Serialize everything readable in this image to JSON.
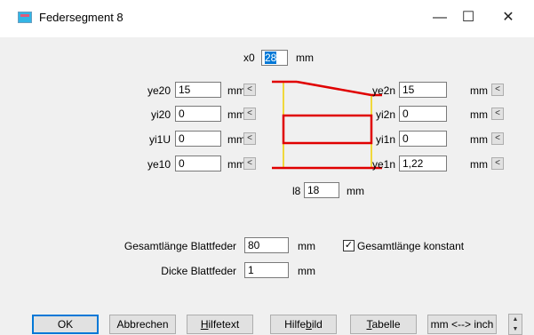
{
  "window": {
    "title": "Federsegment 8",
    "minimize": "—",
    "maximize": "☐",
    "close": "✕"
  },
  "x0": {
    "label": "x0",
    "value": "28",
    "unit": "mm"
  },
  "left_fields": [
    {
      "label": "ye20",
      "value": "15",
      "unit": "mm",
      "btn": "<"
    },
    {
      "label": "yi20",
      "value": "0",
      "unit": "mm",
      "btn": "<"
    },
    {
      "label": "yi1U",
      "value": "0",
      "unit": "mm",
      "btn": "<"
    },
    {
      "label": "ye10",
      "value": "0",
      "unit": "mm",
      "btn": "<"
    }
  ],
  "right_fields": [
    {
      "label": "ye2n",
      "value": "15",
      "unit": "mm",
      "btn": "<"
    },
    {
      "label": "yi2n",
      "value": "0",
      "unit": "mm",
      "btn": "<"
    },
    {
      "label": "yi1n",
      "value": "0",
      "unit": "mm",
      "btn": "<"
    },
    {
      "label": "ye1n",
      "value": "1,22",
      "unit": "mm",
      "btn": "<"
    }
  ],
  "l8": {
    "label": "l8",
    "value": "18",
    "unit": "mm"
  },
  "total_length": {
    "label": "Gesamtlänge Blattfeder",
    "value": "80",
    "unit": "mm"
  },
  "thickness": {
    "label": "Dicke Blattfeder",
    "value": "1",
    "unit": "mm"
  },
  "constant_checkbox": {
    "label": "Gesamtlänge konstant",
    "checked": true,
    "mark": "✓"
  },
  "buttons": {
    "ok": "OK",
    "cancel": "Abbrechen",
    "help_text_prefix": "",
    "help_text_u": "H",
    "help_text_rest": "ilfetext",
    "help_image_pre": "Hilfe",
    "help_image_u": "b",
    "help_image_rest": "ild",
    "table_u": "T",
    "table_rest": "abelle",
    "units": "mm <--> inch"
  },
  "spinner": {
    "up": "▲",
    "down": "▼"
  },
  "colors": {
    "diagram_red": "#e00000",
    "diagram_yellow": "#f0d000",
    "ok_border": "#0078d7"
  }
}
